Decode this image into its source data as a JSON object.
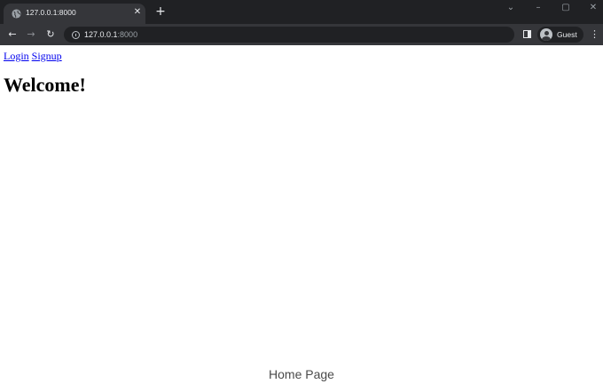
{
  "browser": {
    "tab": {
      "title": "127.0.0.1:8000",
      "favicon": "globe-icon"
    },
    "new_tab_icon": "plus-icon",
    "window_controls": {
      "tabsearch_icon": "chevron-down-icon",
      "minimize_icon": "minimize-icon",
      "maximize_icon": "maximize-icon",
      "close_icon": "close-icon"
    },
    "address": {
      "host": "127.0.0.1",
      "port": ":8000",
      "info_icon": "info-icon"
    },
    "profile": {
      "label": "Guest",
      "icon": "avatar-icon"
    },
    "colors": {
      "tabbar": "#202124",
      "toolbar": "#35363a",
      "omnibox": "#202124"
    }
  },
  "page": {
    "links": [
      {
        "label": "Login"
      },
      {
        "label": "Signup"
      }
    ],
    "heading": "Welcome!",
    "link_color": "#0000ee"
  },
  "caption": "Home Page"
}
